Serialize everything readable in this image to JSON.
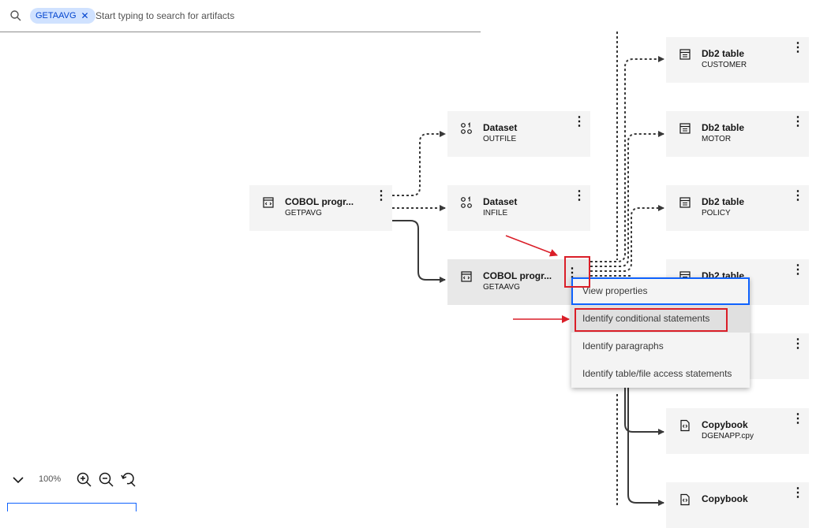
{
  "search": {
    "tag": "GETAAVG",
    "placeholder": "Start typing to search for artifacts"
  },
  "nodes": [
    {
      "title": "COBOL progr...",
      "subtitle": "GETPAVG",
      "icon": "code-icon"
    },
    {
      "title": "Dataset",
      "subtitle": "OUTFILE",
      "icon": "dataset-icon"
    },
    {
      "title": "Dataset",
      "subtitle": "INFILE",
      "icon": "dataset-icon"
    },
    {
      "title": "COBOL progr...",
      "subtitle": "GETAAVG",
      "icon": "code-icon"
    },
    {
      "title": "Db2 table",
      "subtitle": "CUSTOMER",
      "icon": "table-icon"
    },
    {
      "title": "Db2 table",
      "subtitle": "MOTOR",
      "icon": "table-icon"
    },
    {
      "title": "Db2 table",
      "subtitle": "POLICY",
      "icon": "table-icon"
    },
    {
      "title": "Db2 table",
      "subtitle": "",
      "icon": "table-icon"
    },
    {
      "title": "Copybook",
      "subtitle": "DGENAPP.cpy",
      "icon": "copybook-icon"
    },
    {
      "title": "Copybook",
      "subtitle": "",
      "icon": "copybook-icon"
    }
  ],
  "kebab": "⋮",
  "context_menu": {
    "items": [
      {
        "label": "View properties"
      },
      {
        "label": "Identify conditional statements"
      },
      {
        "label": "Identify paragraphs"
      },
      {
        "label": "Identify table/file access statements"
      }
    ]
  },
  "zoom": {
    "level": "100%"
  },
  "colors": {
    "tag_bg": "#d0e2ff",
    "tag_text": "#0043ce",
    "focus": "#0f62fe",
    "annotation": "#da1e28",
    "node_bg": "#f4f4f4"
  }
}
